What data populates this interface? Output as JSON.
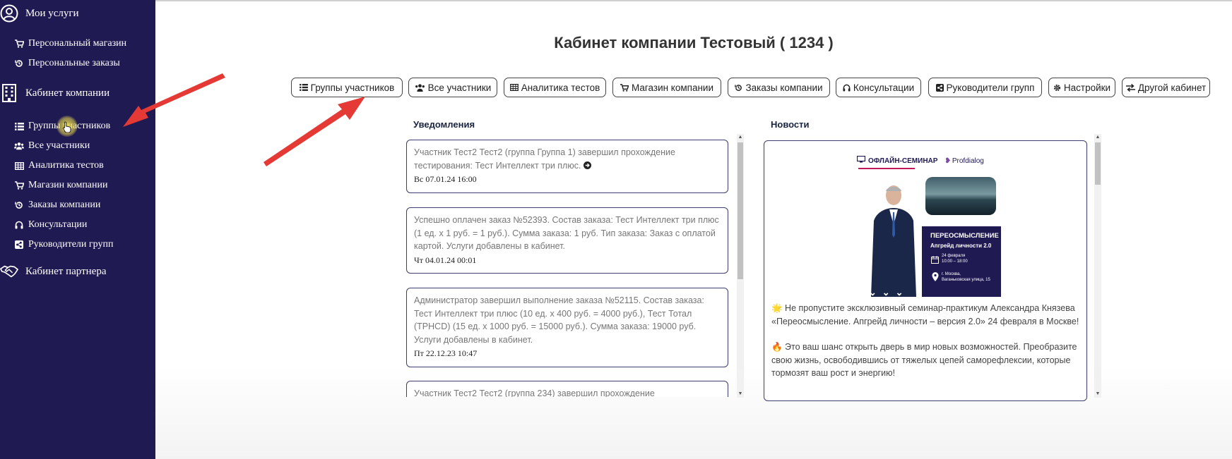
{
  "sidebar": {
    "my_services": "Мои услуги",
    "personal_shop": "Персональный магазин",
    "personal_orders": "Персональные заказы",
    "company_cabinet": "Кабинет компании",
    "items": [
      {
        "label": "Группы участников",
        "icon": "list-icon"
      },
      {
        "label": "Все участники",
        "icon": "users-icon"
      },
      {
        "label": "Аналитика тестов",
        "icon": "table-icon"
      },
      {
        "label": "Магазин компании",
        "icon": "cart-icon"
      },
      {
        "label": "Заказы компании",
        "icon": "history-icon"
      },
      {
        "label": "Консультации",
        "icon": "headphones-icon"
      },
      {
        "label": "Руководители групп",
        "icon": "share-icon"
      }
    ],
    "partner_cabinet": "Кабинет партнера"
  },
  "page": {
    "title": "Кабинет компании Тестовый ( 1234 )"
  },
  "tabs": [
    {
      "label": "Группы участников",
      "icon": "list-icon"
    },
    {
      "label": "Все участники",
      "icon": "users-icon"
    },
    {
      "label": "Аналитика тестов",
      "icon": "table-icon"
    },
    {
      "label": "Магазин компании",
      "icon": "cart-icon"
    },
    {
      "label": "Заказы компании",
      "icon": "history-icon"
    },
    {
      "label": "Консультации",
      "icon": "headphones-icon"
    },
    {
      "label": "Руководители групп",
      "icon": "share-icon"
    },
    {
      "label": "Настройки",
      "icon": "gear-icon"
    },
    {
      "label": "Другой кабинет",
      "icon": "exchange-icon"
    }
  ],
  "notifications": {
    "title": "Уведомления",
    "items": [
      {
        "message": "Участник Тест2 Тест2 (группа Группа 1) завершил прохождение тестирования: Тест Интеллект три плюс.",
        "datetime": "Вс 07.01.24 16:00"
      },
      {
        "message": "Успешно оплачен заказ №52393. Состав заказа: Тест Интеллект три плюс (1 ед. x 1 руб. = 1 руб.). Сумма заказа: 1 руб. Тип заказа: Заказ с оплатой картой. Услуги добавлены в кабинет.",
        "datetime": "Чт 04.01.24 00:01"
      },
      {
        "message": "Администратор завершил выполнение заказа №52115. Состав заказа: Тест Интеллект три плюс (10 ед. x 400 руб. = 4000 руб.), Тест Тотал (ТРНСD) (15 ед. x 1000 руб. = 15000 руб.).  Сумма заказа: 19000 руб. Услуги добавлены в кабинет.",
        "datetime": "Пт 22.12.23 10:47"
      },
      {
        "message": "Участник Тест2 Тест2 (группа 234) завершил прохождение",
        "datetime": ""
      }
    ]
  },
  "news": {
    "title": "Новости",
    "poster": {
      "badge": "ОФЛАЙН-СЕМИНАР",
      "brand": "Profdialog",
      "headline": "ПЕРЕОСМЫСЛЕНИЕ",
      "subheadline": "Апгрейд личности 2.0",
      "date": "24 февраля\n10:00 – 18:00",
      "place": "г. Москва,\nВаганьковская улица, 15"
    },
    "paragraphs": [
      "🌟 Не пропустите эксклюзивный семинар-практикум Александра Князева «Переосмысление. Апгрейд личности – версия 2.0» 24 февраля в Москве!",
      "🔥 Это ваш шанс открыть дверь в мир новых возможностей. Преобразите свою жизнь, освободившись от тяжелых цепей саморефлексии, которые тормозят ваш рост и энергию!"
    ]
  },
  "colors": {
    "sidebar_bg": "#1f1a52",
    "annotation_arrow": "#e53935",
    "card_border": "#3b3e6e"
  }
}
